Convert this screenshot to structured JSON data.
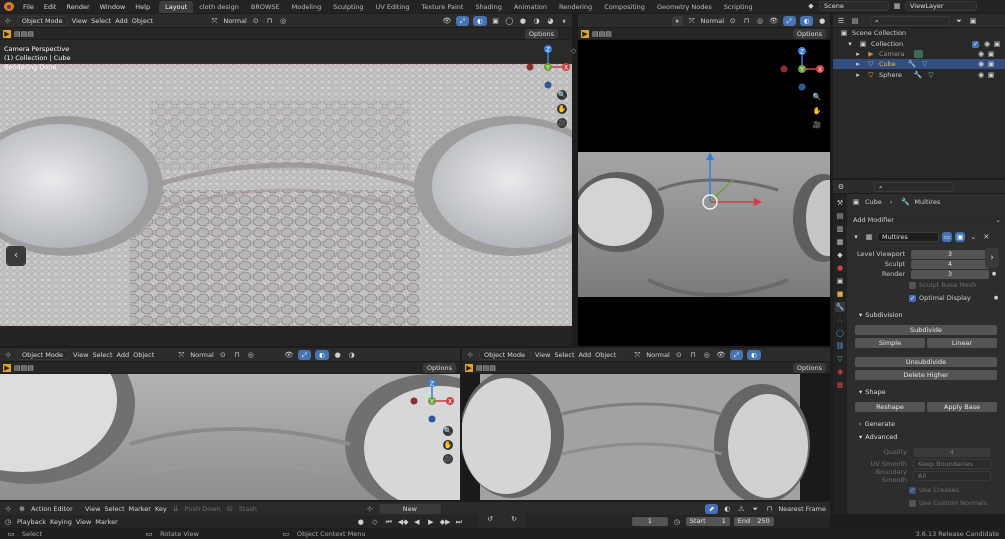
{
  "topbar": {
    "menus": [
      "File",
      "Edit",
      "Render",
      "Window",
      "Help"
    ],
    "workspace_tabs": [
      "Layout",
      "cloth design",
      "BROWSE",
      "Modeling",
      "Sculpting",
      "UV Editing",
      "Texture Paint",
      "Shading",
      "Animation",
      "Rendering",
      "Compositing",
      "Geometry Nodes",
      "Scripting"
    ],
    "active_tab": "Layout",
    "scene": "Scene",
    "view_layer": "ViewLayer"
  },
  "viewport_main": {
    "mode": "Object Mode",
    "menus": [
      "View",
      "Select",
      "Add",
      "Object"
    ],
    "orientation": "Normal",
    "options_label": "Options",
    "overlay_lines": [
      "Camera Perspective",
      "(1) Collection | Cube",
      "Rendering Done"
    ]
  },
  "viewport_tr": {
    "orientation": "Normal",
    "options_label": "Options"
  },
  "viewport_bl": {
    "mode": "Object Mode",
    "menus": [
      "View",
      "Select",
      "Add",
      "Object"
    ],
    "orientation": "Normal",
    "options_label": "Options"
  },
  "viewport_br": {
    "mode": "Object Mode",
    "menus": [
      "View",
      "Select",
      "Add",
      "Object"
    ],
    "orientation": "Normal",
    "options_label": "Options"
  },
  "gizmo_labels": {
    "x": "X",
    "y": "Y",
    "z": "Z"
  },
  "outliner": {
    "root": "Scene Collection",
    "collection": "Collection",
    "items": [
      "Camera",
      "Cube",
      "Sphere"
    ],
    "selected": "Cube"
  },
  "properties": {
    "object": "Cube",
    "modifier_crumb": "Multires",
    "add_modifier": "Add Modifier",
    "modifier_name": "Multires",
    "level_viewport_label": "Level Viewport",
    "level_viewport": "3",
    "sculpt_label": "Sculpt",
    "sculpt": "4",
    "render_label": "Render",
    "render": "3",
    "sculpt_base_mesh": "Sculpt Base Mesh",
    "optimal_display": "Optimal Display",
    "subdivision": "Subdivision",
    "subdivide": "Subdivide",
    "simple": "Simple",
    "linear": "Linear",
    "unsubdivide": "Unsubdivide",
    "delete_higher": "Delete Higher",
    "shape": "Shape",
    "reshape": "Reshape",
    "apply_base": "Apply Base",
    "generate": "Generate",
    "advanced": "Advanced",
    "quality_label": "Quality",
    "quality": "4",
    "uv_smooth_label": "UV Smooth",
    "uv_smooth": "Keep Boundaries",
    "boundary_smooth_label": "Boundary Smooth",
    "boundary_smooth": "All",
    "use_creases": "Use Creases",
    "use_custom_normals": "Use Custom Normals"
  },
  "timeline": {
    "editor": "Action Editor",
    "menus": [
      "View",
      "Select",
      "Marker",
      "Key"
    ],
    "push_down": "Push Down",
    "stash": "Stash",
    "new_label": "New",
    "snap": "Nearest Frame",
    "playback": "Playback",
    "keying": "Keying",
    "view": "View",
    "marker": "Marker",
    "current_frame": "1",
    "start_label": "Start",
    "start": "1",
    "end_label": "End",
    "end": "250"
  },
  "statusbar": {
    "select": "Select",
    "rotate": "Rotate View",
    "context": "Object Context Menu",
    "version": "3.6.13 Release Candidate"
  }
}
